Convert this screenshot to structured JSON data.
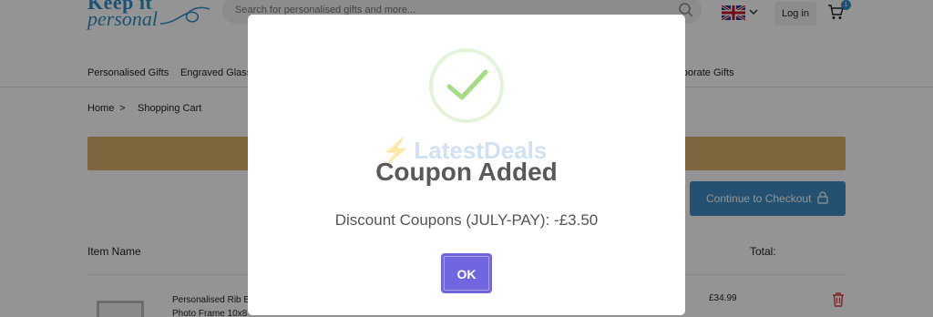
{
  "header": {
    "logo_line1": "Keep it",
    "logo_line2": "personal",
    "search_placeholder": "Search for personalised gifts and more...",
    "login_label": "Log in",
    "cart_count": "1"
  },
  "nav": {
    "items": [
      "Personalised Gifts",
      "Engraved Glass",
      "Corporate Gifts"
    ]
  },
  "breadcrumb": {
    "home": "Home",
    "separator": ">",
    "current": "Shopping Cart"
  },
  "checkout_label": "Continue to Checkout",
  "table": {
    "headers": {
      "item": "Item Name",
      "total": "Total:"
    },
    "rows": [
      {
        "name_line1": "Personalised Rib B",
        "name_line2": "Photo Frame 10x8",
        "price": "£34.99"
      }
    ]
  },
  "modal": {
    "watermark": "LatestDeals",
    "title": "Coupon Added",
    "text": "Discount Coupons (JULY-PAY): -£3.50",
    "ok_label": "OK"
  },
  "colors": {
    "brand": "#2f8fc4",
    "banner": "#d9b068",
    "checkout": "#3f8cc3",
    "ok_button": "#7066e0",
    "success": "#a5dc86"
  }
}
